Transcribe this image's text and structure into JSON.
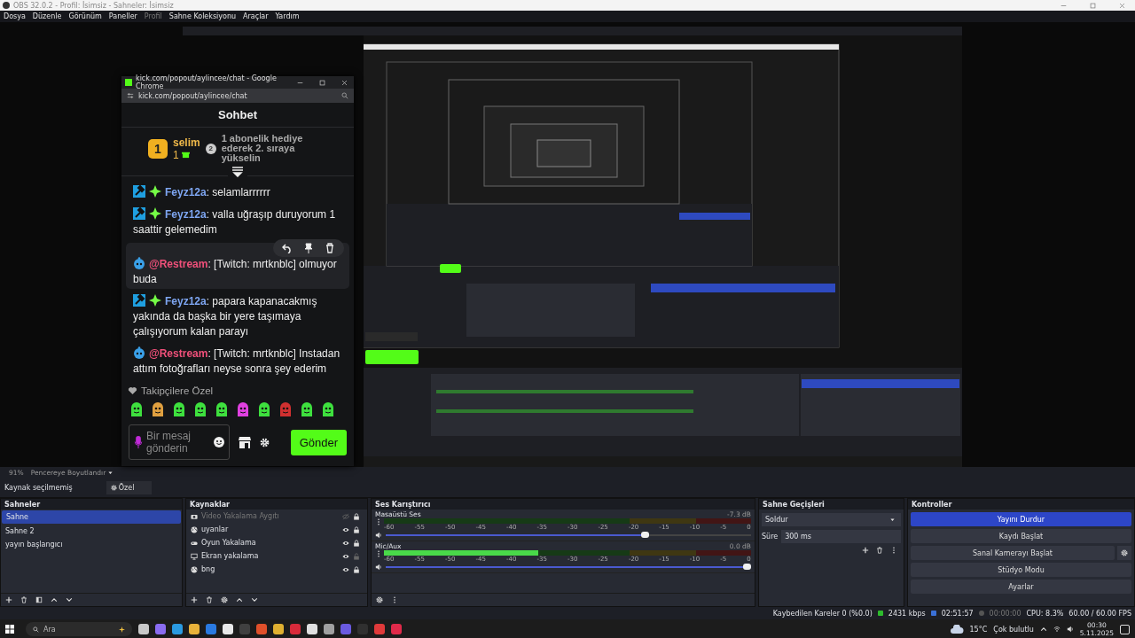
{
  "window": {
    "title": "OBS 32.0.2 - Profil: İsimsiz - Sahneler: İsimsiz"
  },
  "menu": [
    {
      "label": "Dosya",
      "disabled": false
    },
    {
      "label": "Düzenle",
      "disabled": false
    },
    {
      "label": "Görünüm",
      "disabled": false
    },
    {
      "label": "Paneller",
      "disabled": false
    },
    {
      "label": "Profil",
      "disabled": true
    },
    {
      "label": "Sahne Koleksiyonu",
      "disabled": false
    },
    {
      "label": "Araçlar",
      "disabled": false
    },
    {
      "label": "Yardım",
      "disabled": false
    }
  ],
  "preview_toolbar": {
    "zoom": "91%",
    "fit": "Pencereye Boyutlandır"
  },
  "source_bar": {
    "status": "Kaynak seçilmemiş",
    "properties": "Özel"
  },
  "scenes": {
    "title": "Sahneler",
    "items": [
      {
        "name": "Sahne",
        "selected": true
      },
      {
        "name": "Sahne 2",
        "selected": false
      },
      {
        "name": "yayın başlangıcı",
        "selected": false
      }
    ]
  },
  "sources": {
    "title": "Kaynaklar",
    "items": [
      {
        "name": "Video Yakalama Aygıtı",
        "kind": "camera",
        "visible": false,
        "locked": true
      },
      {
        "name": "uyanlar",
        "kind": "browser",
        "visible": true,
        "locked": true
      },
      {
        "name": "Oyun Yakalama",
        "kind": "game",
        "visible": true,
        "locked": true
      },
      {
        "name": "Ekran yakalama",
        "kind": "display",
        "visible": true,
        "locked": false
      },
      {
        "name": "bng",
        "kind": "browser",
        "visible": true,
        "locked": true
      }
    ]
  },
  "mixer": {
    "title": "Ses Karıştırıcı",
    "channels": [
      {
        "name": "Masaüstü Ses",
        "reading": "-7.3 dB",
        "level": 0.72,
        "ticks": [
          "-60",
          "-55",
          "-50",
          "-45",
          "-40",
          "-35",
          "-30",
          "-25",
          "-20",
          "-15",
          "-10",
          "-5",
          "0"
        ]
      },
      {
        "name": "Mic/Aux",
        "reading": "0.0 dB",
        "level": 1.0,
        "meter": {
          "level": 0.42
        },
        "ticks": [
          "-60",
          "-55",
          "-50",
          "-45",
          "-40",
          "-35",
          "-30",
          "-25",
          "-20",
          "-15",
          "-10",
          "-5",
          "0"
        ]
      }
    ]
  },
  "transitions": {
    "title": "Sahne Geçişleri",
    "transition": "Soldur",
    "duration_label": "Süre",
    "duration": "300 ms"
  },
  "controls": {
    "title": "Kontroller",
    "buttons": [
      {
        "label": "Yayını Durdur",
        "active": true,
        "settings": false
      },
      {
        "label": "Kaydı Başlat",
        "active": false,
        "settings": false
      },
      {
        "label": "Sanal Kamerayı Başlat",
        "active": false,
        "settings": true
      },
      {
        "label": "Stüdyo Modu",
        "active": false,
        "settings": false
      },
      {
        "label": "Ayarlar",
        "active": false,
        "settings": false
      }
    ]
  },
  "status_bar": {
    "dropped": "Kaybedilen Kareler 0 (%0.0)",
    "bitrate": "2431 kbps",
    "stream_time": "02:51:57",
    "record_time": "00:00:00",
    "cpu": "CPU: 8.3%",
    "fps": "60.00 / 60.00 FPS"
  },
  "chat_window": {
    "title": "kick.com/popout/aylincee/chat - Google Chrome",
    "url": "kick.com/popout/aylincee/chat",
    "heading": "Sohbet",
    "leader": {
      "rank": "1",
      "name": "selim",
      "count": "1",
      "next_rank": "2",
      "hint": "1 abonelik hediye ederek 2. sıraya yükselin"
    },
    "messages": [
      {
        "badges": [
          {
            "kind": "moderator"
          },
          {
            "kind": "sparkle"
          }
        ],
        "user": "Feyz12a",
        "color": "#7ea6f2",
        "text": ": selamlarrrrrr",
        "hovered": false
      },
      {
        "badges": [
          {
            "kind": "moderator"
          },
          {
            "kind": "sparkle"
          }
        ],
        "user": "Feyz12a",
        "color": "#7ea6f2",
        "text": ": valla uğraşıp duruyorum 1 saattir gelemedim",
        "hovered": false
      },
      {
        "badges": [
          {
            "kind": "bot"
          }
        ],
        "user": "@Restream",
        "color": "#f0507a",
        "text": ": [Twitch: mrtknblc] olmuyor buda",
        "hovered": true
      },
      {
        "badges": [
          {
            "kind": "moderator"
          },
          {
            "kind": "sparkle"
          }
        ],
        "user": "Feyz12a",
        "color": "#7ea6f2",
        "text": ": papara kapanacakmış yakında da başka bir yere taşımaya çalışıyorum kalan parayı",
        "hovered": false
      },
      {
        "badges": [
          {
            "kind": "bot"
          }
        ],
        "user": "@Restream",
        "color": "#f0507a",
        "text": ": [Twitch: mrtknblc] Instadan attım fotoğrafları neyse sonra şey ederim",
        "hovered": false
      }
    ],
    "emote_title": "Takipçilere Özel",
    "emotes": [
      {
        "color": "#3ee03e"
      },
      {
        "color": "#e0a040"
      },
      {
        "color": "#3ee03e"
      },
      {
        "color": "#3ee03e"
      },
      {
        "color": "#3ee03e"
      },
      {
        "color": "#e040e0"
      },
      {
        "color": "#3ee03e"
      },
      {
        "color": "#d03030"
      },
      {
        "color": "#3ee03e"
      },
      {
        "color": "#3ee03e"
      }
    ],
    "placeholder": "Bir mesaj gönderin",
    "send": "Gönder"
  },
  "taskbar": {
    "search": "Ara",
    "apps": [
      {
        "color": "#c8c8c8"
      },
      {
        "color": "#8a6cf0"
      },
      {
        "color": "#2a9ae0"
      },
      {
        "color": "#e8b23a"
      },
      {
        "color": "#2a7ae0"
      },
      {
        "color": "#e8e8e8"
      },
      {
        "color": "#404040"
      },
      {
        "color": "#e0502a"
      },
      {
        "color": "#e0b030"
      },
      {
        "color": "#d82a3a"
      },
      {
        "color": "#e0e0e0"
      },
      {
        "color": "#a0a0a0"
      },
      {
        "color": "#6a5ae0"
      },
      {
        "color": "#303030"
      },
      {
        "color": "#e03a3a"
      },
      {
        "color": "#e02a4a"
      }
    ],
    "temperature": "15°C",
    "weather": "Çok bulutlu",
    "time": "00:30",
    "date": "5.11.2025"
  }
}
